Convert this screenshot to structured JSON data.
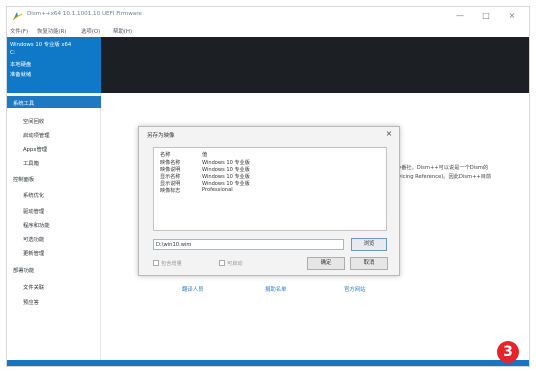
{
  "window": {
    "title": "Dism++x64 10.1.1001.10 UEFI Firmware",
    "controls": [
      "—",
      "□",
      "×"
    ]
  },
  "menu": [
    "文件(F)",
    "恢复功能(R)",
    "选项(O)",
    "帮助(H)"
  ],
  "os_panel": {
    "name": "Windows 10 专业版 x64",
    "id": "C:",
    "line3": "本地硬盘",
    "line4": "准备就绪"
  },
  "sidebar": {
    "active": "系统工具",
    "items": [
      "空间回收",
      "启动项管理",
      "Appx管理",
      "工具箱"
    ],
    "group2": "控制面板",
    "items2": [
      "系统优化",
      "驱动管理",
      "程序和功能",
      "可选功能",
      "更新管理"
    ],
    "group3": "部署功能",
    "items3": [
      "文件关联",
      "预应答"
    ]
  },
  "content": {
    "line1": "小番社。Dism++可以说是一个Dism的",
    "line2": "rvicing Reference)。因此Dism++目前",
    "links": [
      "翻译人员",
      "捐助名单",
      "官方网站"
    ]
  },
  "dialog": {
    "title": "另存为映像",
    "close": "×",
    "columns": [
      "名称",
      "值"
    ],
    "rows": [
      [
        "映像名称",
        "Windows 10 专业版"
      ],
      [
        "映像说明",
        "Windows 10 专业版"
      ],
      [
        "显示名称",
        "Windows 10 专业版"
      ],
      [
        "显示说明",
        "Windows 10 专业版"
      ],
      [
        "映像标志",
        "Professional"
      ]
    ],
    "path_value": "D:\\win10.wim",
    "browse": "浏览",
    "checkbox1": "包含增量",
    "checkbox2": "可启动",
    "ok": "确定",
    "cancel": "取消"
  },
  "step_badge": "3",
  "colors": {
    "accent": "#1f78c2",
    "header_dark": "#1c1f24",
    "link": "#2f7fcf",
    "badge": "#e5252a"
  }
}
